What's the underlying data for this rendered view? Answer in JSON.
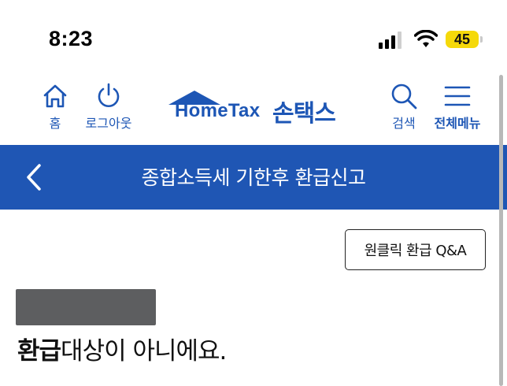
{
  "status_bar": {
    "time": "8:23",
    "battery": "45",
    "icons": [
      "cellular-signal-icon",
      "wifi-icon",
      "battery-icon"
    ]
  },
  "header": {
    "home_label": "홈",
    "logout_label": "로그아웃",
    "logo_text": "HomeTax",
    "logo_korean": "손택스",
    "search_label": "검색",
    "menu_label": "전체메뉴",
    "brand_color": "#1d56b5"
  },
  "title_bar": {
    "title": "종합소득세 기한후 환급신고",
    "back_icon": "chevron-left-icon",
    "color": "#1f56b4"
  },
  "content": {
    "qa_button": "원클릭 환급 Q&A",
    "result_bold": "환급",
    "result_rest": "대상이 아니에요."
  }
}
